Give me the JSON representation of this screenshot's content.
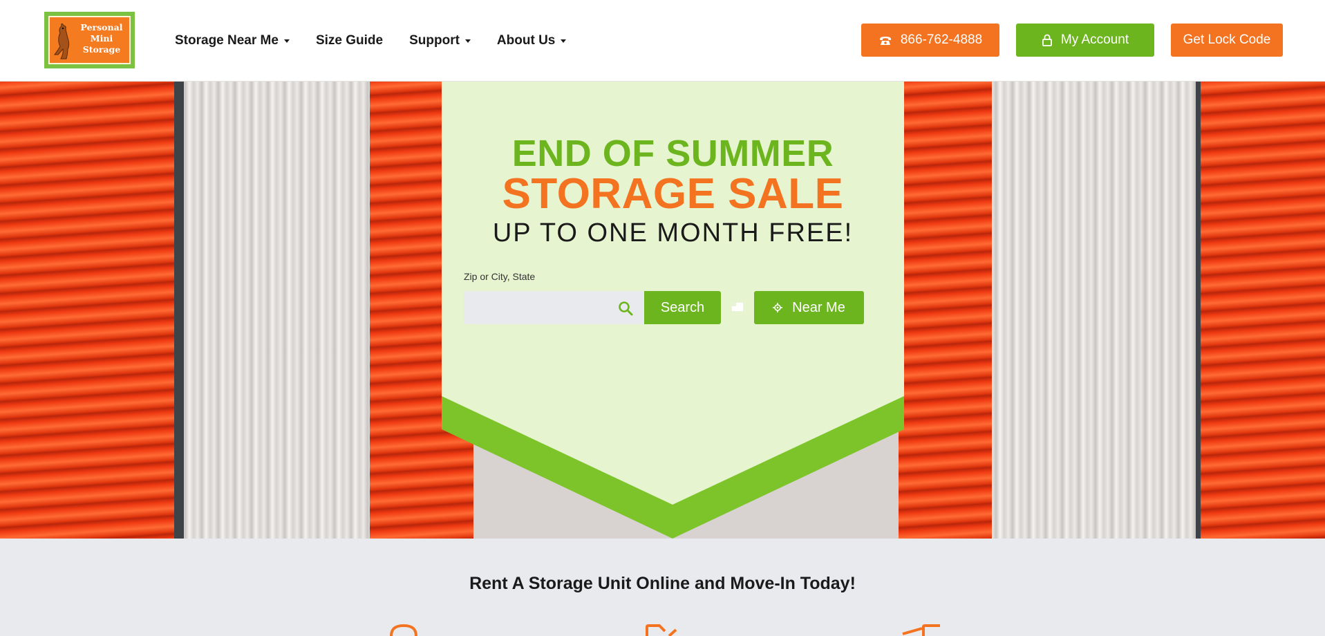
{
  "brand": {
    "logo_lines": [
      "Personal",
      "Mini",
      "Storage"
    ],
    "logo_icon": "kangaroo-icon"
  },
  "nav": {
    "items": [
      {
        "label": "Storage Near Me",
        "dropdown": true
      },
      {
        "label": "Size Guide",
        "dropdown": false
      },
      {
        "label": "Support",
        "dropdown": true
      },
      {
        "label": "About Us",
        "dropdown": true
      }
    ]
  },
  "header_buttons": {
    "phone": {
      "label": "866-762-4888",
      "icon": "phone-icon"
    },
    "account": {
      "label": "My Account",
      "icon": "lock-icon"
    },
    "lock_code": {
      "label": "Get Lock Code"
    }
  },
  "hero": {
    "line1": "END OF SUMMER",
    "line2": "STORAGE SALE",
    "line3": "UP TO ONE MONTH FREE!",
    "search": {
      "label": "Zip or City, State",
      "value": "",
      "placeholder": "",
      "search_button": "Search",
      "near_me_button": "Near Me"
    }
  },
  "section": {
    "title": "Rent A Storage Unit Online and Move-In Today!"
  },
  "colors": {
    "orange": "#f47321",
    "green": "#6db51f",
    "banner_light": "#eef8dc",
    "banner_dark": "#7cc42a",
    "section_bg": "#e9eaee"
  }
}
